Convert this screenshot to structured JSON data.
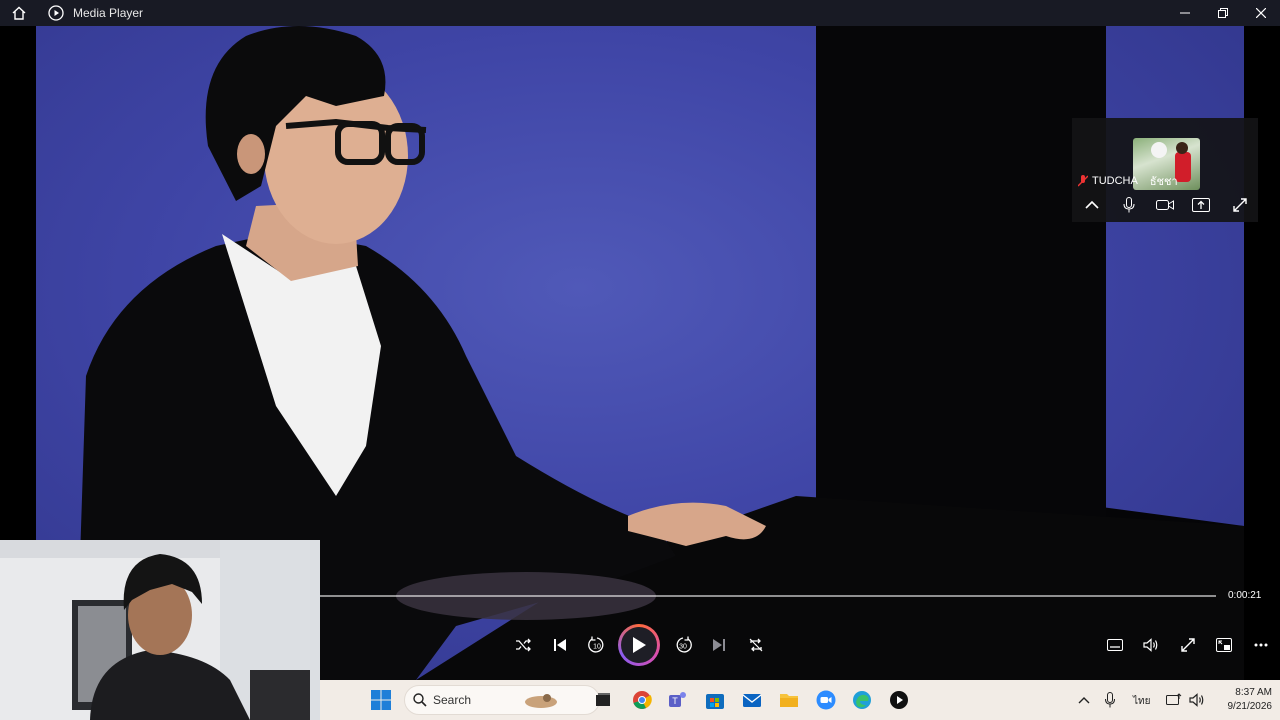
{
  "window": {
    "title": "Media Player",
    "icons": [
      "home-icon",
      "media-player-icon",
      "minimize-icon",
      "restore-icon",
      "close-icon"
    ]
  },
  "zoom_panel": {
    "participant_name": "TUDCHA",
    "participant_name_thai": "ธัชชา",
    "controls": [
      "chevron-up-icon",
      "microphone-icon",
      "video-camera-icon",
      "share-screen-icon",
      "expand-icon"
    ]
  },
  "player": {
    "elapsed": "0:00:21",
    "progress": 0.0,
    "controls": [
      "shuffle-icon",
      "previous-icon",
      "rewind-10-icon",
      "play-icon",
      "forward-30-icon",
      "next-icon",
      "repeat-icon",
      "captions-icon",
      "volume-icon",
      "fullscreen-icon",
      "miniplayer-icon",
      "more-icon"
    ],
    "rewind_label": "10",
    "forward_label": "30"
  },
  "taskbar": {
    "search_placeholder": "Search",
    "apps": [
      "windows-start-icon",
      "search-icon",
      "widget-icon",
      "taskview-icon",
      "chrome-icon",
      "teams-icon",
      "store-icon",
      "mail-icon",
      "file-explorer-icon",
      "zoom-icon",
      "edge-icon",
      "media-player-icon"
    ],
    "tray": {
      "language": "ไทย",
      "time": "8:37 AM",
      "date": "9/21/2026"
    }
  },
  "colors": {
    "titlebar_bg": "#181a24",
    "video_bg": "#3f45a6",
    "taskbar_bg": "#f2ece6",
    "play_ring_start": "#ff6a3d",
    "play_ring_end": "#8a5cf0"
  }
}
